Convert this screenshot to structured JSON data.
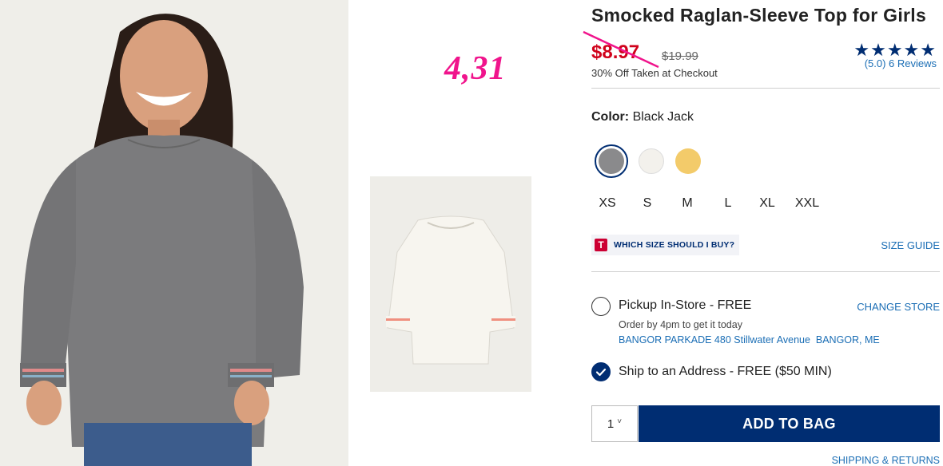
{
  "product": {
    "title": "Smocked Raglan-Sleeve Top for Girls",
    "sale_price": "$8.97",
    "original_price": "$19.99",
    "promo_text": "30% Off Taken at Checkout",
    "rating_stars": "★★★★★",
    "rating_value": 5.0,
    "reviews_text": "(5.0) 6 Reviews"
  },
  "overlay_price": "4,31",
  "color": {
    "label": "Color:",
    "selected": "Black Jack",
    "swatches": [
      {
        "hex": "#8a8a8c",
        "selected": true
      },
      {
        "hex": "#f3f1ec",
        "selected": false
      },
      {
        "hex": "#f3cb6a",
        "selected": false
      }
    ]
  },
  "sizes": [
    "XS",
    "S",
    "M",
    "L",
    "XL",
    "XXL"
  ],
  "size_help": {
    "icon": "T",
    "label": "WHICH SIZE SHOULD I BUY?",
    "guide_link": "SIZE GUIDE"
  },
  "fulfillment": {
    "pickup": {
      "label": "Pickup In-Store - FREE",
      "change_store": "CHANGE STORE",
      "order_by": "Order by 4pm to get it today",
      "store_address": "BANGOR PARKADE 480 Stillwater Avenue  BANGOR, ME",
      "checked": false
    },
    "ship": {
      "label": "Ship to an Address - FREE ($50 MIN)",
      "checked": true
    }
  },
  "quantity": {
    "value": "1",
    "chevron": "˅"
  },
  "add_to_bag": "ADD TO BAG",
  "shipping_returns": "SHIPPING & RETURNS",
  "colors": {
    "navy": "#002d72",
    "sale_red": "#d0021b",
    "link_blue": "#1b6eb5",
    "overlay_pink": "#f0148c"
  }
}
